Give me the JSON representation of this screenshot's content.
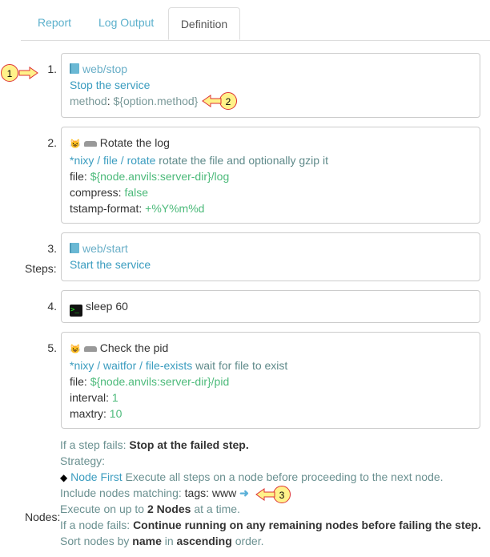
{
  "tabs": [
    {
      "label": "Report"
    },
    {
      "label": "Log Output"
    },
    {
      "label": "Definition",
      "active": true
    }
  ],
  "labels": {
    "steps": "Steps:",
    "nodes": "Nodes:"
  },
  "steps": [
    {
      "num": "1.",
      "icon": "book-icon",
      "job": "web/stop",
      "desc": "Stop the service",
      "opt_key": "method",
      "opt_val": "${option.method}"
    },
    {
      "num": "2.",
      "title": "Rotate the log",
      "plugin": "*nixy / file / rotate",
      "plugin_desc": "rotate the file and optionally gzip it",
      "config": [
        {
          "k": "file:",
          "v": "${node.anvils:server-dir}/log"
        },
        {
          "k": "compress:",
          "v": "false"
        },
        {
          "k": "tstamp-format:",
          "v": "+%Y%m%d"
        }
      ]
    },
    {
      "num": "3.",
      "icon": "book-icon",
      "job": "web/start",
      "desc": "Start the service"
    },
    {
      "num": "4.",
      "icon": "terminal-icon",
      "command": "sleep 60"
    },
    {
      "num": "5.",
      "title": "Check the pid",
      "plugin": "*nixy / waitfor / file-exists",
      "plugin_desc": "wait for file to exist",
      "config": [
        {
          "k": "file:",
          "v": "${node.anvils:server-dir}/pid"
        },
        {
          "k": "interval:",
          "v": "1"
        },
        {
          "k": "maxtry:",
          "v": "10"
        }
      ]
    }
  ],
  "settings": {
    "step_fail_label": "If a step fails:",
    "step_fail_value": "Stop at the failed step.",
    "strategy_label": "Strategy:",
    "strategy_name": "Node First",
    "strategy_desc": "Execute all steps on a node before proceeding to the next node.",
    "include_label": "Include nodes matching:",
    "include_value": "tags: www",
    "exec_pre": "Execute on up to",
    "exec_value": "2 Nodes",
    "exec_post": "at a time.",
    "node_fail_label": "If a node fails:",
    "node_fail_value": "Continue running on any remaining nodes before failing the step.",
    "sort_pre": "Sort nodes by",
    "sort_key": "name",
    "sort_mid": "in",
    "sort_dir": "ascending",
    "sort_post": "order."
  },
  "callouts": [
    "1",
    "2",
    "3"
  ],
  "colors": {
    "link": "#3a9cbf",
    "value": "#4cba7a",
    "callout": "#fff28a"
  }
}
